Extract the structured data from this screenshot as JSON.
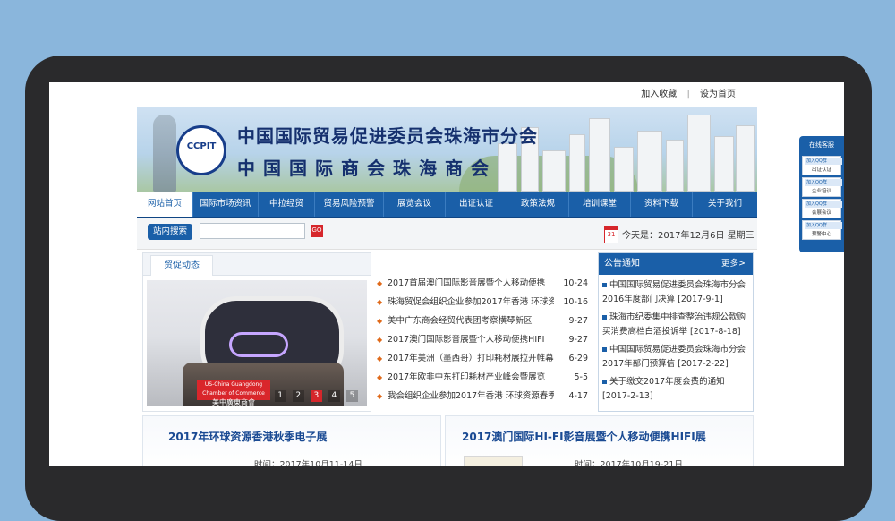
{
  "topbar": {
    "add_favorite": "加入收藏",
    "separator": "|",
    "set_homepage": "设为首页"
  },
  "banner": {
    "logo_text": "CCPIT",
    "title_line1": "中国国际贸易促进委员会珠海市分会",
    "title_line2": "中国国际商会珠海商会"
  },
  "nav": {
    "items": [
      {
        "label": "网站首页"
      },
      {
        "label": "国际市场资讯"
      },
      {
        "label": "中拉经贸"
      },
      {
        "label": "贸易风险预警"
      },
      {
        "label": "展览会议"
      },
      {
        "label": "出证认证"
      },
      {
        "label": "政策法规"
      },
      {
        "label": "培训课堂"
      },
      {
        "label": "资料下载"
      },
      {
        "label": "关于我们"
      }
    ]
  },
  "search": {
    "label": "站内搜索",
    "go": "GO",
    "calendar_day": "31",
    "today": "今天是：2017年12月6日 星期三"
  },
  "news": {
    "tab": "贸促动态",
    "slideshow": {
      "banner_text": "美中廣東商會",
      "sub_text": "US-China Guangdong Chamber of Commerce",
      "pages": [
        "1",
        "2",
        "3",
        "4",
        "5"
      ],
      "active_page": "3"
    },
    "items": [
      {
        "title": "2017首届澳门国际影音展暨个人移动便携",
        "date": "10-24"
      },
      {
        "title": "珠海贸促会组织企业参加2017年香港 环球资",
        "date": "10-16"
      },
      {
        "title": "美中广东商会经贸代表团考察横琴新区",
        "date": "9-27"
      },
      {
        "title": "2017澳门国际影音展暨个人移动便携HIFI",
        "date": "9-27"
      },
      {
        "title": "2017年美洲（墨西哥）打印耗材展拉开帷幕",
        "date": "6-29"
      },
      {
        "title": "2017年欧非中东打印耗材产业峰会暨展览",
        "date": "5-5"
      },
      {
        "title": "我会组织企业参加2017年香港 环球资源春季",
        "date": "4-17"
      }
    ]
  },
  "notice": {
    "title": "公告通知",
    "more": "更多>",
    "items": [
      {
        "text": "中国国际贸易促进委员会珠海市分会2016年度部门决算 [2017-9-1]"
      },
      {
        "text": "珠海市纪委集中排查整治违规公款购买消费高档白酒投诉举 [2017-8-18]"
      },
      {
        "text": "中国国际贸易促进委员会珠海市分会2017年部门预算信 [2017-2-22]"
      },
      {
        "text": "关于缴交2017年度会费的通知 [2017-2-13]"
      }
    ]
  },
  "cards": [
    {
      "title": "2017年环球资源香港秋季电子展",
      "meta": "时间：2017年10月11-14日"
    },
    {
      "title": "2017澳门国际HI-FI影音展暨个人移动便携HIFI展",
      "meta": "时间：2017年10月19-21日"
    }
  ],
  "service": {
    "title": "在线客服",
    "items": [
      {
        "button": "加入QQ群",
        "label": "出证认证"
      },
      {
        "button": "加入QQ群",
        "label": "企业培训"
      },
      {
        "button": "加入QQ群",
        "label": "会展会议"
      },
      {
        "button": "加入QQ群",
        "label": "预警中心"
      }
    ]
  },
  "colors": {
    "background": "#8ab6dc",
    "bezel": "#2a2a2c",
    "nav": "#1a5fa8",
    "accent_red": "#d6262b",
    "title_blue": "#15306e"
  }
}
